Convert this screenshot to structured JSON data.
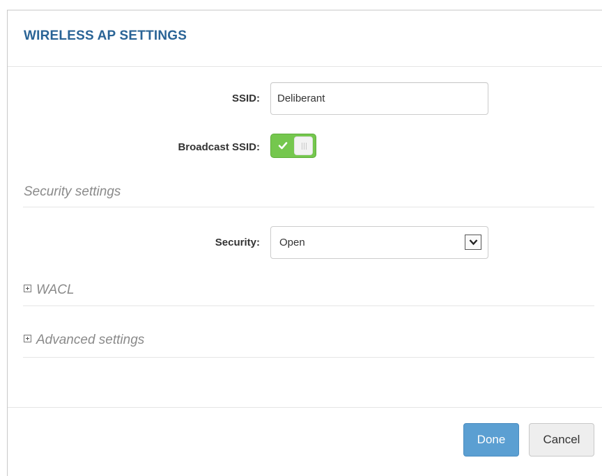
{
  "dialog": {
    "title": "WIRELESS AP SETTINGS"
  },
  "ssid": {
    "label": "SSID:",
    "value": "Deliberant"
  },
  "broadcast_ssid": {
    "label": "Broadcast SSID:",
    "enabled": true
  },
  "security_section": {
    "heading": "Security settings",
    "security_label": "Security:",
    "security_value": "Open"
  },
  "wacl": {
    "label": "WACL"
  },
  "advanced": {
    "label": "Advanced settings"
  },
  "footer": {
    "done_label": "Done",
    "cancel_label": "Cancel"
  },
  "colors": {
    "title": "#2a6496",
    "toggle_on": "#75c74e",
    "primary_button": "#5b9fd2"
  },
  "icons": {
    "toggle": "checkmark-icon",
    "select": "chevron-down-icon",
    "expander": "plus-box-icon"
  }
}
